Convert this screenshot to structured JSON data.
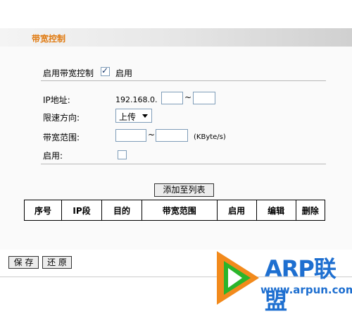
{
  "header": {
    "title": "带宽控制"
  },
  "enable_section": {
    "label": "启用带宽控制",
    "checked": true,
    "checkbox_label": "启用"
  },
  "form": {
    "ip_label": "IP地址:",
    "ip_prefix": "192.168.0.",
    "ip_start": "",
    "ip_tilde": "~",
    "ip_end": "",
    "direction_label": "限速方向:",
    "direction_value": "上传",
    "range_label": "带宽范围:",
    "range_min": "",
    "range_tilde": "~",
    "range_max": "",
    "range_unit": "(KByte/s)",
    "enable_label": "启用:",
    "enable_checked": false
  },
  "add_button": "添加至列表",
  "table": {
    "columns": [
      "序号",
      "IP段",
      "目的",
      "带宽范围",
      "启用",
      "编辑",
      "删除"
    ]
  },
  "footer": {
    "save_label": "保 存",
    "restore_label": "还 原"
  },
  "watermark": {
    "brand": "ARP联盟",
    "url": "www.arpun.com"
  },
  "colors": {
    "title": "#e07a10",
    "brand_blue": "#1e6fd0",
    "logo_green": "#2bb52b",
    "logo_orange": "#f28a1c"
  }
}
